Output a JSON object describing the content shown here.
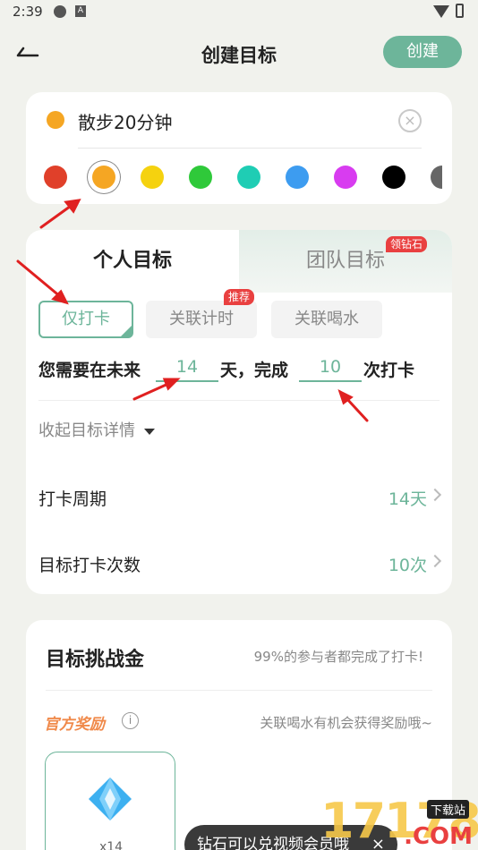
{
  "status_bar": {
    "time": "2:39",
    "icon_b_glyph": "A"
  },
  "header": {
    "title": "创建目标",
    "create_label": "创建"
  },
  "name_card": {
    "goal_name": "散步20分钟",
    "selected_color": "#f5a623",
    "colors": [
      "#e0402a",
      "#f5a623",
      "#f5d20f",
      "#2fc93a",
      "#1fcdb4",
      "#3d9cf0",
      "#d83cf0",
      "#000000",
      "#666666"
    ]
  },
  "goal_card": {
    "tab_personal": "个人目标",
    "tab_team": "团队目标",
    "team_badge": "领钻石",
    "modes": [
      "仅打卡",
      "关联计时",
      "关联喝水"
    ],
    "recommend_badge": "推荐",
    "sentence_prefix": "您需要在未来",
    "days_value": "14",
    "sentence_mid": "天，完成",
    "times_value": "10",
    "sentence_suffix": "次打卡",
    "collapse_label": "收起目标详情",
    "period_label": "打卡周期",
    "period_value": "14天",
    "count_label": "目标打卡次数",
    "count_value": "10次"
  },
  "challenge_card": {
    "title": "目标挑战金",
    "subtitle": "99%的参与者都完成了打卡!",
    "reward_title": "官方奖励",
    "info_glyph": "i",
    "reward_subtitle": "关联喝水有机会获得奖励哦~",
    "reward_count": "x14"
  },
  "toast": {
    "text": "钻石可以兑视频会员哦",
    "close": "×"
  },
  "watermark": {
    "digits": "17178",
    "badge": "下载站",
    "domain": ".COM"
  },
  "accent_color": "#6db59a"
}
